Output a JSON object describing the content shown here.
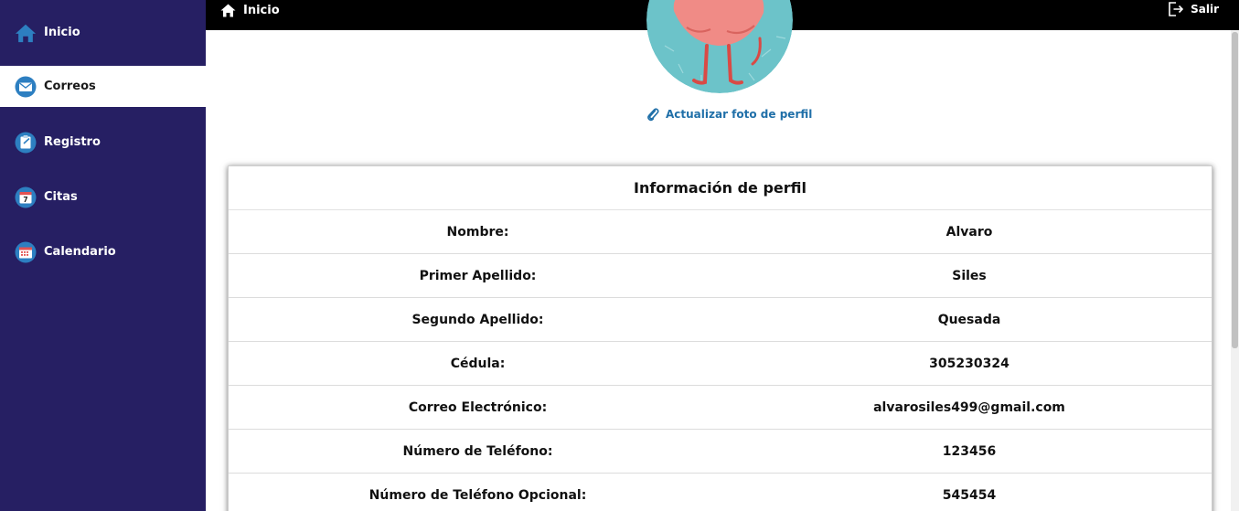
{
  "sidebar": {
    "items": [
      {
        "label": "Inicio",
        "icon": "home-icon"
      },
      {
        "label": "Correos",
        "icon": "mail-icon"
      },
      {
        "label": "Registro",
        "icon": "clipboard-icon"
      },
      {
        "label": "Citas",
        "icon": "calendar-7-icon"
      },
      {
        "label": "Calendario",
        "icon": "calendar-icon"
      }
    ],
    "active_index": 1
  },
  "topbar": {
    "home_label": "Inicio",
    "logout_label": "Salir"
  },
  "profile": {
    "update_photo_label": "Actualizar foto de perfil"
  },
  "info": {
    "title": "Información de perfil",
    "rows": [
      {
        "label": "Nombre:",
        "value": "Alvaro"
      },
      {
        "label": "Primer Apellido:",
        "value": "Siles"
      },
      {
        "label": "Segundo Apellido:",
        "value": "Quesada"
      },
      {
        "label": "Cédula:",
        "value": "305230324"
      },
      {
        "label": "Correo Electrónico:",
        "value": "alvarosiles499@gmail.com"
      },
      {
        "label": "Número de Teléfono:",
        "value": "123456"
      },
      {
        "label": "Número de Teléfono Opcional:",
        "value": "545454"
      }
    ]
  },
  "colors": {
    "sidebar_bg": "#261f63",
    "topbar_bg": "#000000",
    "accent": "#1f6fa8",
    "avatar_bg": "#6cc3c9"
  }
}
